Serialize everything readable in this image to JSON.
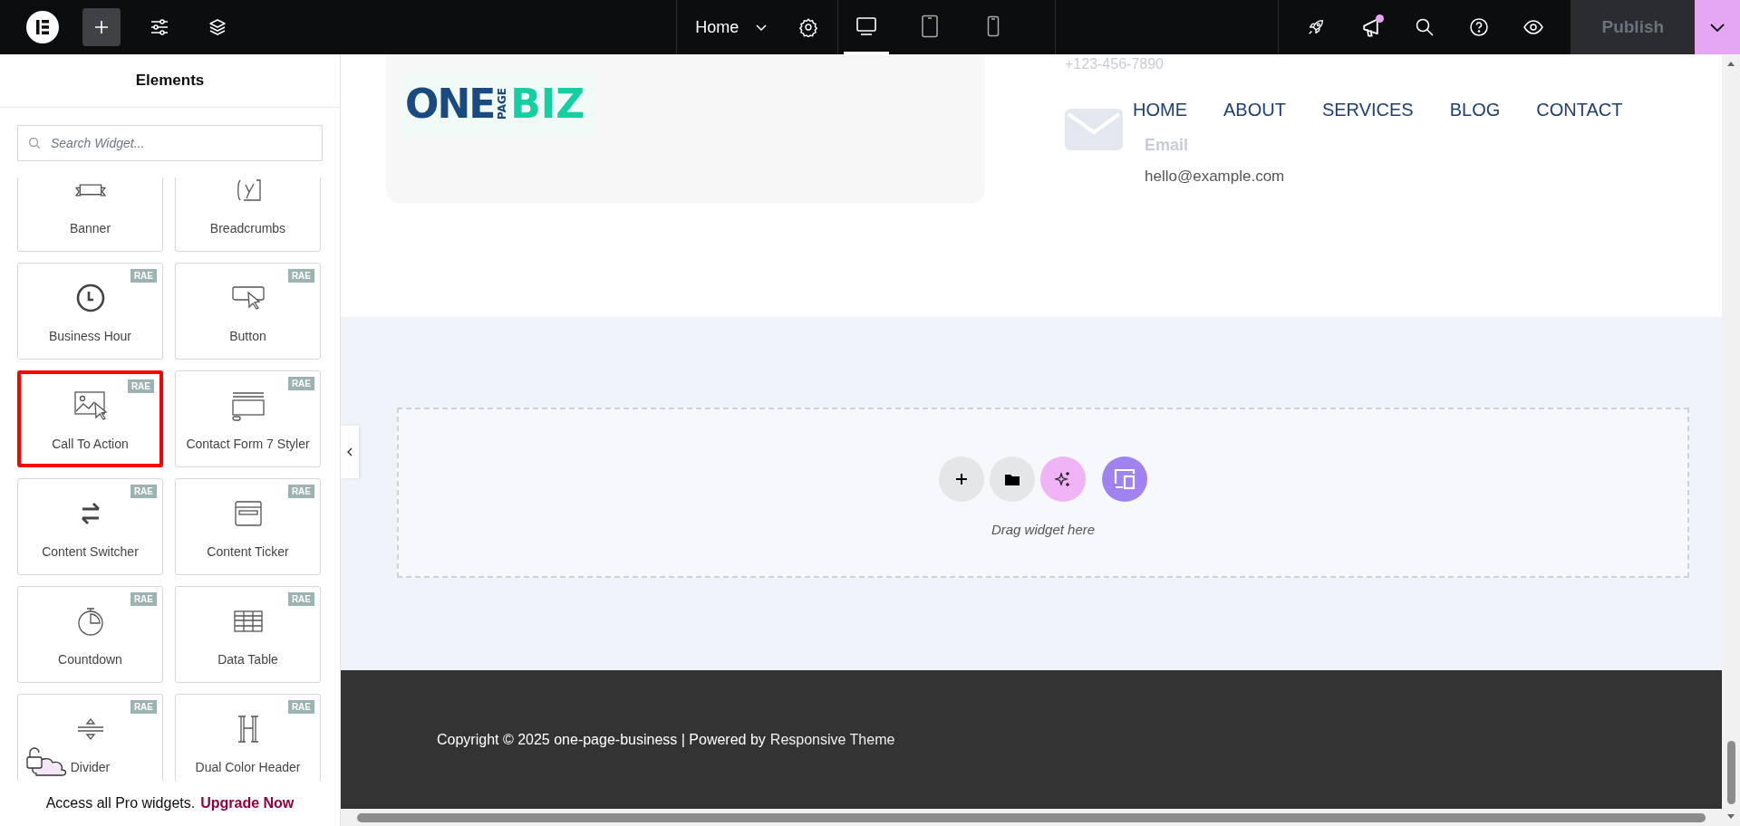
{
  "topbar": {
    "tools": [
      {
        "kind": "add",
        "selected": true
      },
      {
        "kind": "settings",
        "selected": false
      },
      {
        "kind": "structure",
        "selected": false
      }
    ],
    "page_menu": {
      "label": "Home"
    },
    "devices": [
      {
        "kind": "desktop",
        "selected": true
      },
      {
        "kind": "tablet",
        "selected": false
      },
      {
        "kind": "mobile",
        "selected": false
      }
    ],
    "actions": [
      {
        "kind": "rocket",
        "notification": false
      },
      {
        "kind": "megaphone",
        "notification": true
      },
      {
        "kind": "search",
        "notification": false
      },
      {
        "kind": "help",
        "notification": false
      },
      {
        "kind": "preview",
        "notification": false
      }
    ],
    "publish": {
      "label": "Publish",
      "disabled": true
    }
  },
  "sidebar": {
    "title": "Elements",
    "search": {
      "placeholder": "Search Widget..."
    },
    "widgets": [
      {
        "label": "Banner",
        "kind": "banner",
        "selected": false
      },
      {
        "label": "Breadcrumbs",
        "kind": "breadcrumbs",
        "selected": false
      },
      {
        "label": "Business Hour",
        "kind": "clock",
        "badge": "RAE",
        "selected": false
      },
      {
        "label": "Button",
        "kind": "button",
        "badge": "RAE",
        "selected": false
      },
      {
        "label": "Call To Action",
        "kind": "cta",
        "badge": "RAE",
        "selected": true
      },
      {
        "label": "Contact Form 7 Styler",
        "kind": "form",
        "badge": "RAE",
        "selected": false
      },
      {
        "label": "Content Switcher",
        "kind": "switcher",
        "badge": "RAE",
        "selected": false
      },
      {
        "label": "Content Ticker",
        "kind": "ticker",
        "badge": "RAE",
        "selected": false
      },
      {
        "label": "Countdown",
        "kind": "countdown",
        "badge": "RAE",
        "selected": false
      },
      {
        "label": "Data Table",
        "kind": "table",
        "badge": "RAE",
        "selected": false
      },
      {
        "label": "Divider",
        "kind": "divider",
        "badge": "RAE",
        "selected": false
      },
      {
        "label": "Dual Color Header",
        "kind": "heading",
        "badge": "RAE",
        "selected": false
      }
    ],
    "promo": {
      "text": "Access all Pro widgets.",
      "link": "Upgrade Now"
    }
  },
  "canvas": {
    "header": {
      "logo": {
        "part_1": "ONE",
        "part_2": "PAGE",
        "part_3": "BIZ"
      },
      "contacts": [
        {
          "kind": "phone",
          "value": "+123-456-7890"
        },
        {
          "kind": "email",
          "label": "Email",
          "value": "hello@example.com"
        }
      ],
      "nav": [
        "HOME",
        "ABOUT",
        "SERVICES",
        "BLOG",
        "CONTACT"
      ]
    },
    "drop_zone": {
      "hint": "Drag widget here"
    },
    "footer": {
      "text": "Copyright © 2025 one-page-business | Powered by",
      "link": "Responsive Theme"
    }
  }
}
